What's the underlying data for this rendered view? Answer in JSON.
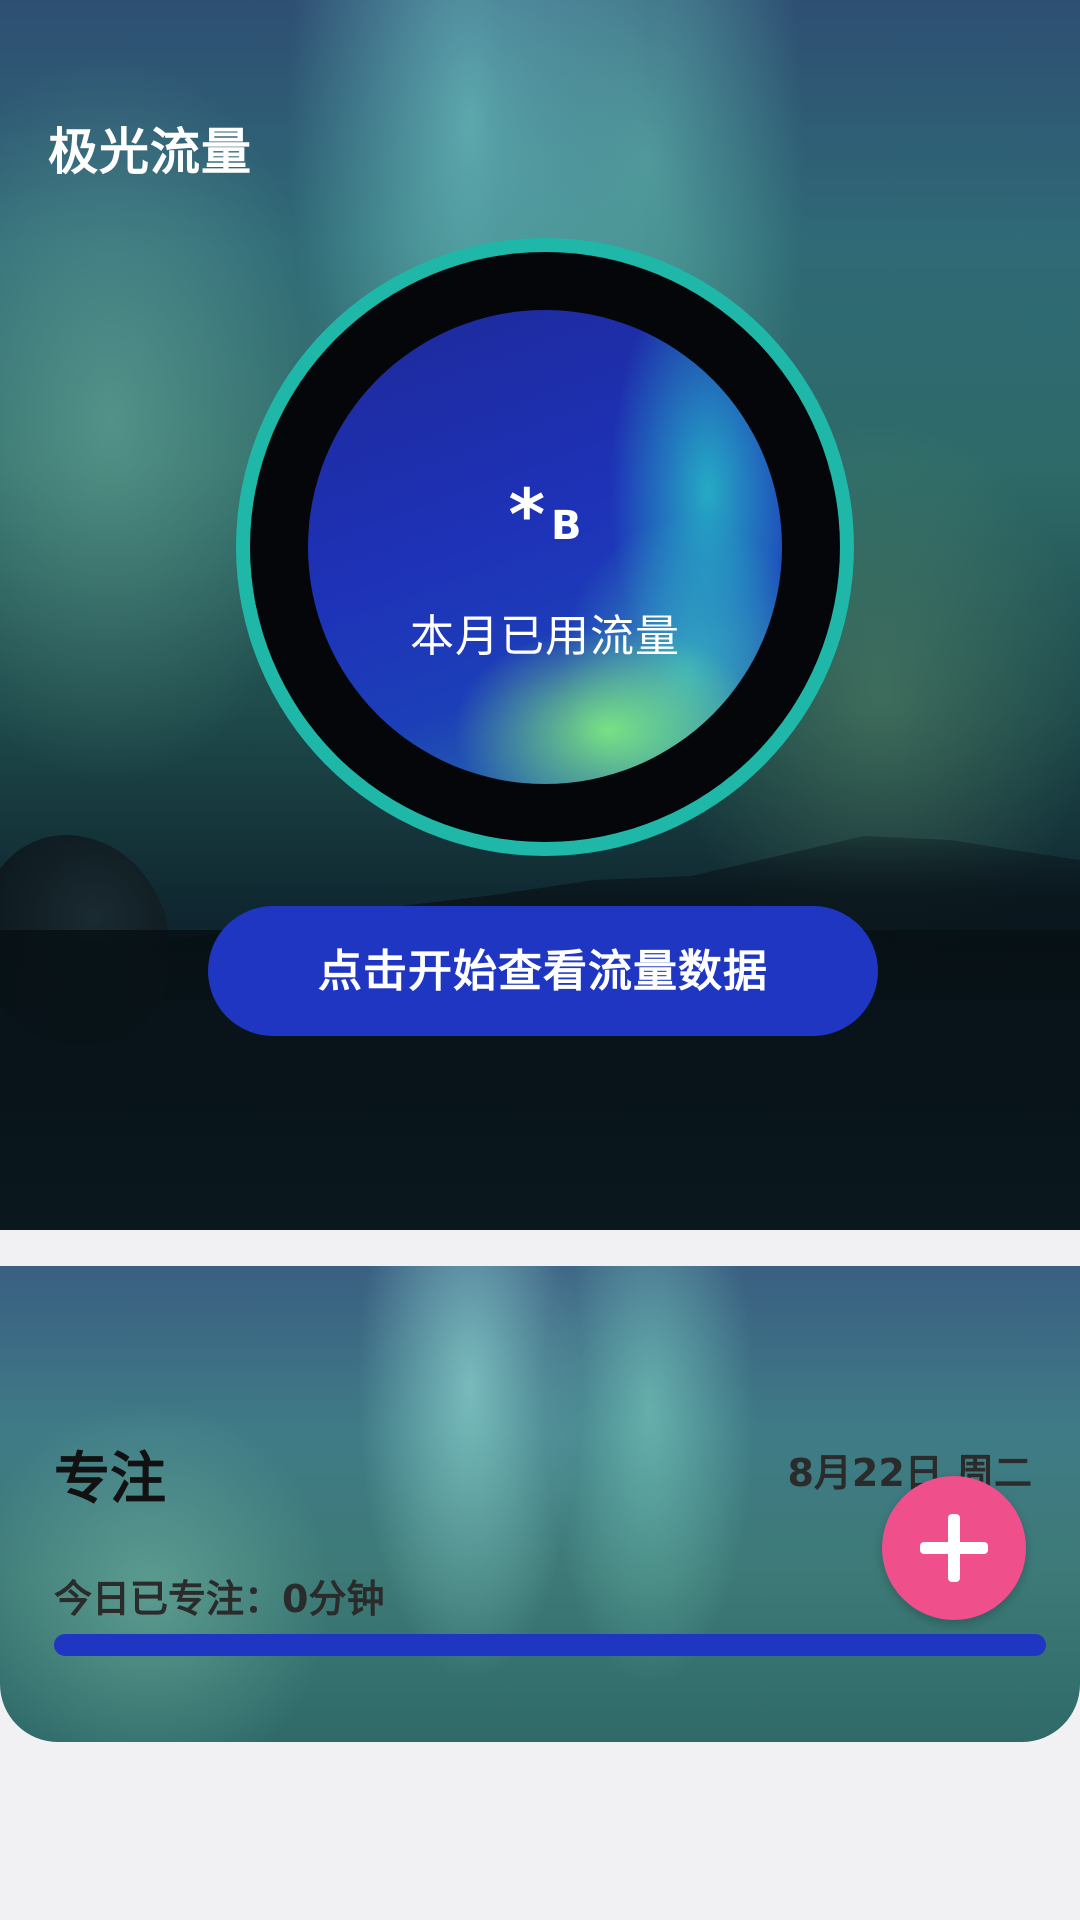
{
  "header": {
    "title": "极光流量"
  },
  "usage": {
    "value": "*",
    "unit": "B",
    "label": "本月已用流量"
  },
  "start_button": {
    "label": "点击开始查看流量数据"
  },
  "focus": {
    "title": "专注",
    "date": "8月22日 周二",
    "today_label": "今日已专注：0分钟",
    "progress": 0
  },
  "fab": {
    "icon": "plus-icon"
  },
  "colors": {
    "ring": "#1fb7a7",
    "button": "#1f36c2",
    "fab": "#ef4f8b"
  }
}
